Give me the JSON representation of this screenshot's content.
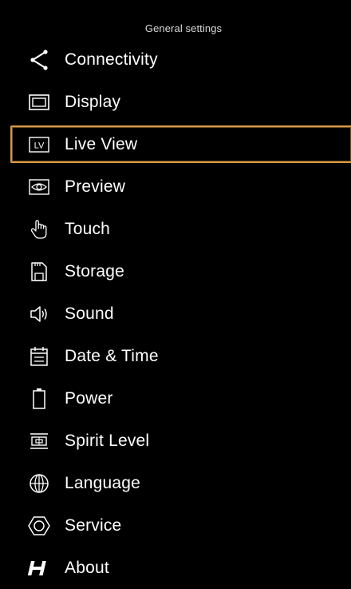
{
  "header": {
    "title": "General settings"
  },
  "selection_color": "#d89a4a",
  "menu": {
    "items": [
      {
        "label": "Connectivity",
        "icon": "share-icon",
        "selected": false
      },
      {
        "label": "Display",
        "icon": "display-icon",
        "selected": false
      },
      {
        "label": "Live View",
        "icon": "live-view-icon",
        "selected": true
      },
      {
        "label": "Preview",
        "icon": "preview-eye-icon",
        "selected": false
      },
      {
        "label": "Touch",
        "icon": "touch-hand-icon",
        "selected": false
      },
      {
        "label": "Storage",
        "icon": "sd-card-icon",
        "selected": false
      },
      {
        "label": "Sound",
        "icon": "speaker-icon",
        "selected": false
      },
      {
        "label": "Date & Time",
        "icon": "calendar-icon",
        "selected": false
      },
      {
        "label": "Power",
        "icon": "battery-icon",
        "selected": false
      },
      {
        "label": "Spirit Level",
        "icon": "spirit-level-icon",
        "selected": false
      },
      {
        "label": "Language",
        "icon": "globe-icon",
        "selected": false
      },
      {
        "label": "Service",
        "icon": "service-hexagon-icon",
        "selected": false
      },
      {
        "label": "About",
        "icon": "hasselblad-logo-icon",
        "selected": false
      }
    ]
  }
}
